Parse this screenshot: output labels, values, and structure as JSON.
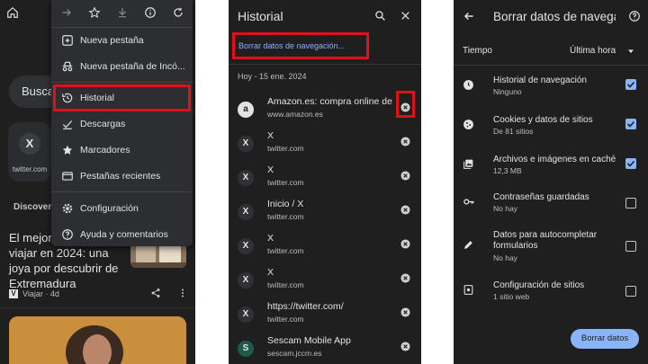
{
  "panel1": {
    "search_text": "Busca",
    "shortcut": {
      "icon": "x-logo",
      "glyph": "X",
      "label": "twitter.com"
    },
    "discover_label": "Discover",
    "article": {
      "title": "El mejor p... viajar en 2024: una joya por descubrir de Extremadura",
      "title_lines": [
        "El mejor p",
        "viajar en 2024: una",
        "joya por descubrir de",
        "Extremadura"
      ],
      "source_logo": "V",
      "source": "Viajar · 4d"
    },
    "menu": {
      "toolbar_icons": [
        "forward-icon",
        "bookmark-star-icon",
        "download-icon",
        "info-icon",
        "refresh-icon"
      ],
      "items": [
        {
          "label": "Nueva pestaña",
          "icon": "new-tab-icon"
        },
        {
          "label": "Nueva pestaña de Incó...",
          "icon": "incognito-icon"
        },
        {
          "label": "Historial",
          "icon": "history-icon"
        },
        {
          "label": "Descargas",
          "icon": "downloads-icon"
        },
        {
          "label": "Marcadores",
          "icon": "star-icon"
        },
        {
          "label": "Pestañas recientes",
          "icon": "recent-tabs-icon"
        },
        {
          "label": "Configuración",
          "icon": "gear-icon"
        },
        {
          "label": "Ayuda y comentarios",
          "icon": "help-icon"
        }
      ]
    }
  },
  "panel2": {
    "title": "Historial",
    "clear_link": "Borrar datos de navegación...",
    "date_header": "Hoy - 15 ene. 2024",
    "rows": [
      {
        "title": "Amazon.es: compra online de ...",
        "url": "www.amazon.es",
        "icon": "a"
      },
      {
        "title": "X",
        "url": "twitter.com",
        "icon": "X"
      },
      {
        "title": "X",
        "url": "twitter.com",
        "icon": "X"
      },
      {
        "title": "Inicio / X",
        "url": "twitter.com",
        "icon": "X"
      },
      {
        "title": "X",
        "url": "twitter.com",
        "icon": "X"
      },
      {
        "title": "X",
        "url": "twitter.com",
        "icon": "X"
      },
      {
        "title": "https://twitter.com/",
        "url": "twitter.com",
        "icon": "X"
      },
      {
        "title": "Sescam Mobile App",
        "url": "sescam.jccm.es",
        "icon": "S"
      }
    ]
  },
  "panel3": {
    "title": "Borrar datos de navegación",
    "time_label": "Tiempo",
    "time_value": "Última hora",
    "options": [
      {
        "title": "Historial de navegación",
        "subtitle": "Ninguno",
        "checked": true,
        "icon": "clock-icon"
      },
      {
        "title": "Cookies y datos de sitios",
        "subtitle": "De 81 sitios",
        "checked": true,
        "icon": "cookie-icon"
      },
      {
        "title": "Archivos e imágenes en caché",
        "subtitle": "12,3 MB",
        "checked": true,
        "icon": "image-stack-icon"
      },
      {
        "title": "Contraseñas guardadas",
        "subtitle": "No hay",
        "checked": false,
        "icon": "key-icon"
      },
      {
        "title": "Datos para autocompletar formularios",
        "subtitle": "No hay",
        "checked": false,
        "icon": "pencil-icon"
      },
      {
        "title": "Configuración de sitios",
        "subtitle": "1 sitio web",
        "checked": false,
        "icon": "site-settings-icon"
      }
    ],
    "clear_button": "Borrar datos"
  }
}
